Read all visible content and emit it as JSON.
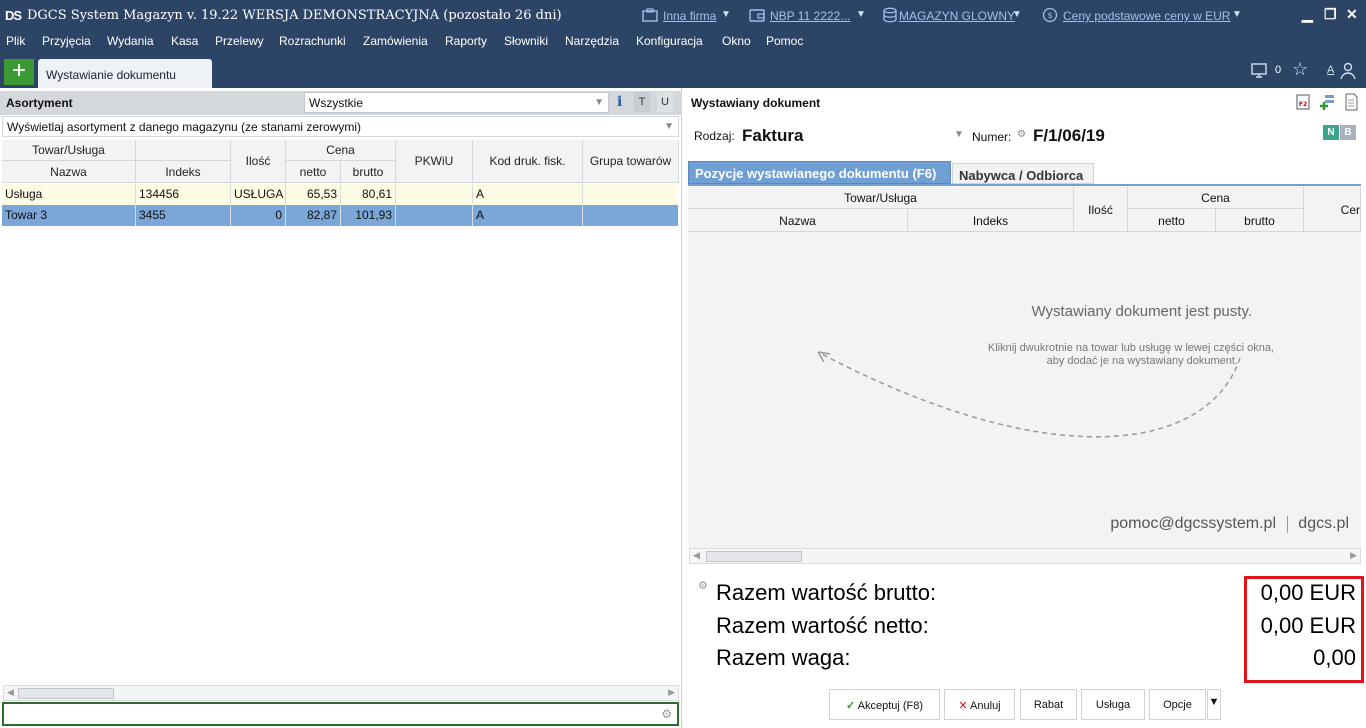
{
  "window": {
    "logo": "DS",
    "title": "DGCS System Magazyn v. 19.22  WERSJA DEMONSTRACYJNA (pozostało 26 dni)",
    "company_link": "Inna firma",
    "rate_link": "NBP 11 2222...",
    "warehouse_link": "MAGAZYN GLOWNY",
    "price_link": "Ceny podstawowe ceny w EUR"
  },
  "menu": [
    "Plik",
    "Przyjęcia",
    "Wydania",
    "Kasa",
    "Przelewy",
    "Rozrachunki",
    "Zamówienia",
    "Raporty",
    "Słowniki",
    "Narzędzia",
    "Konfiguracja",
    "Okno",
    "Pomoc"
  ],
  "tabs": {
    "active": "Wystawianie dokumentu",
    "notification_count": "0",
    "font_label": "A"
  },
  "left": {
    "title": "Asortyment",
    "filter_value": "Wszystkie",
    "btn_t": "T",
    "btn_u": "U",
    "scope_value": "Wyświetlaj asortyment z danego magazynu (ze stanami zerowymi)",
    "headers": {
      "group_item": "Towar/Usługa",
      "name": "Nazwa",
      "index": "Indeks",
      "qty": "Ilość",
      "price": "Cena",
      "net": "netto",
      "gross": "brutto",
      "pkwiu": "PKWiU",
      "fisc": "Kod druk. fisk.",
      "group": "Grupa towarów"
    },
    "rows": [
      {
        "name": "Usługa",
        "index": "134456",
        "qty": "USŁUGA",
        "net": "65,53",
        "gross": "80,61",
        "pkwiu": "",
        "fisc": "A",
        "group": ""
      },
      {
        "name": "Towar 3",
        "index": "3455",
        "qty": "0",
        "net": "82,87",
        "gross": "101,93",
        "pkwiu": "",
        "fisc": "A",
        "group": ""
      }
    ]
  },
  "right": {
    "title": "Wystawiany dokument",
    "type_label": "Rodzaj:",
    "type_value": "Faktura",
    "number_label": "Numer:",
    "number_value": "F/1/06/19",
    "badge_n": "N",
    "badge_b": "B",
    "tab_positions": "Pozycje wystawianego dokumentu (F6)",
    "tab_buyer": "Nabywca / Odbiorca",
    "headers": {
      "group_item": "Towar/Usługa",
      "name": "Nazwa",
      "index": "Indeks",
      "qty": "Ilość",
      "price": "Cena",
      "net": "netto",
      "gross": "brutto",
      "cut": "Cer"
    },
    "empty_title": "Wystawiany dokument jest pusty.",
    "empty_hint_1": "Kliknij dwukrotnie na towar lub usługę w lewej części okna,",
    "empty_hint_2": "aby dodać je na wystawiany dokument.",
    "support_email": "pomoc@dgcssystem.pl",
    "support_site": "dgcs.pl",
    "totals": {
      "gross_label": "Razem wartość brutto:",
      "gross_value": "0,00 EUR",
      "net_label": "Razem wartość netto:",
      "net_value": "0,00 EUR",
      "weight_label": "Razem waga:",
      "weight_value": "0,00"
    },
    "buttons": {
      "accept": "Akceptuj (F8)",
      "cancel": "Anuluj",
      "discount": "Rabat",
      "service": "Usługa",
      "options": "Opcje"
    }
  },
  "colors": {
    "titlebar": "#2c4566",
    "selected_row": "#7aa7d8",
    "highlight_row": "#fdfbe3",
    "active_tab": "#6f9fd3",
    "red_box": "#e0151b"
  }
}
